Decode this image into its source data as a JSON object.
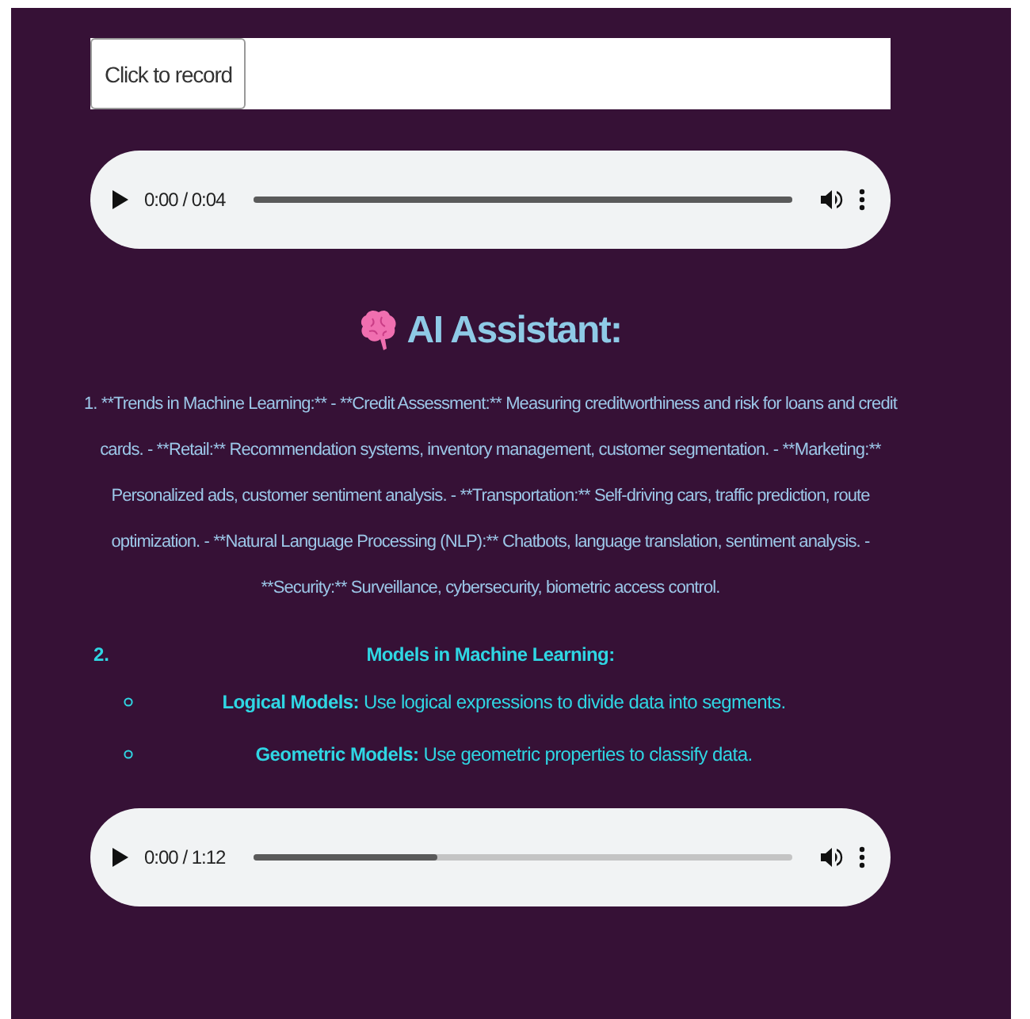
{
  "recorder": {
    "button": "Click to record"
  },
  "players": [
    {
      "time": "0:00 / 0:04",
      "level": 1
    },
    {
      "time": "0:00 / 1:12",
      "level": 0.34
    }
  ],
  "assistant": {
    "heading": "AI Assistant:",
    "paragraph": "1. **Trends in Machine Learning:** - **Credit Assessment:** Measuring creditworthiness and risk for loans and credit cards. - **Retail:** Recommendation systems, inventory management, customer segmentation. - **Marketing:** Personalized ads, customer sentiment analysis. - **Transportation:** Self-driving cars, traffic prediction, route optimization. - **Natural Language Processing (NLP):** Chatbots, language translation, sentiment analysis. - **Security:** Surveillance, cybersecurity, biometric access control.",
    "list": {
      "number": "2.",
      "title": "Models in Machine Learning:",
      "items": [
        "**Logical Models:** Use logical expressions to divide data into segments.",
        "**Geometric Models:** Use geometric properties to classify data."
      ]
    }
  }
}
